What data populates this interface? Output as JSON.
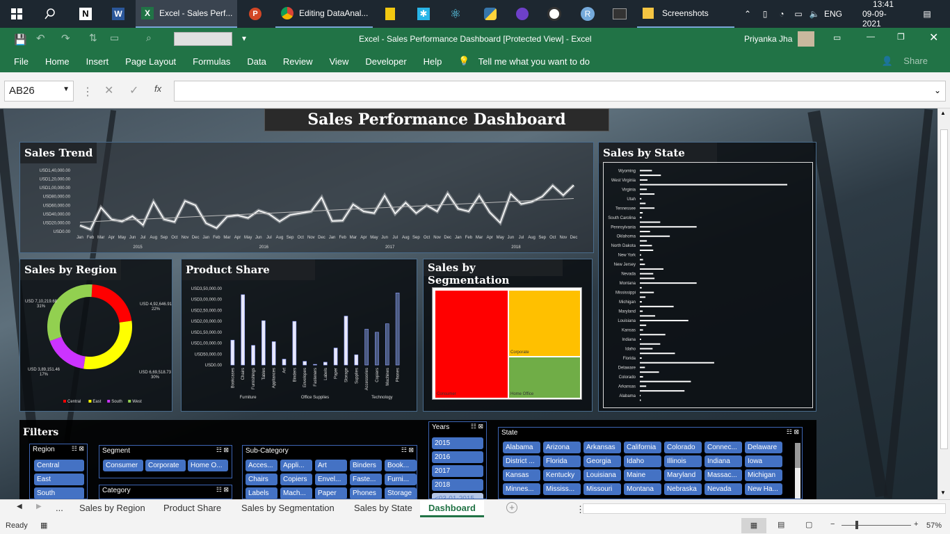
{
  "taskbar": {
    "apps": [
      {
        "label": "Excel - Sales Perf..."
      },
      {
        "label": "Editing DataAnal..."
      },
      {
        "label": "Screenshots"
      }
    ],
    "lang": "ENG",
    "time": "13:41",
    "date": "09-09-2021"
  },
  "excel": {
    "window_title": "Excel - Sales Performance Dashboard [Protected View] - Excel",
    "user": "Priyanka Jha",
    "share": "Share",
    "namebox": "AB26",
    "fx": "fx"
  },
  "ribbon": {
    "tabs": [
      "File",
      "Home",
      "Insert",
      "Page Layout",
      "Formulas",
      "Data",
      "Review",
      "View",
      "Developer",
      "Help"
    ],
    "tell_me": "Tell me what you want to do"
  },
  "dashboard": {
    "title": "Sales Performance Dashboard",
    "trend": {
      "title": "Sales Trend"
    },
    "region": {
      "title": "Sales by Region"
    },
    "product": {
      "title": "Product Share"
    },
    "segmentation": {
      "title": "Sales by Segmentation",
      "labels": [
        "Consumer",
        "Corporate",
        "Home Office"
      ]
    },
    "state": {
      "title": "Sales by State"
    },
    "filters": {
      "title": "Filters"
    }
  },
  "chart_data": [
    {
      "type": "line",
      "title": "Sales Trend",
      "ylim": [
        0,
        140000
      ],
      "yticks": [
        "USD0.00",
        "USD20,000.00",
        "USD40,000.00",
        "USD60,000.00",
        "USD80,000.00",
        "USD1,00,000.00",
        "USD1,20,000.00",
        "USD1,40,000.00"
      ],
      "x": [
        "Jan",
        "Feb",
        "Mar",
        "Apr",
        "May",
        "Jun",
        "Jul",
        "Aug",
        "Sep",
        "Oct",
        "Nov",
        "Dec",
        "Jan",
        "Feb",
        "Mar",
        "Apr",
        "May",
        "Jun",
        "Jul",
        "Aug",
        "Sep",
        "Oct",
        "Nov",
        "Dec",
        "Jan",
        "Feb",
        "Mar",
        "Apr",
        "May",
        "Jun",
        "Jul",
        "Aug",
        "Sep",
        "Oct",
        "Nov",
        "Dec",
        "Jan",
        "Feb",
        "Mar",
        "Apr",
        "May",
        "Jun",
        "Jul",
        "Aug",
        "Sep",
        "Oct",
        "Nov",
        "Dec"
      ],
      "years": [
        "2015",
        "2016",
        "2017",
        "2018"
      ],
      "series": [
        {
          "values": [
            14000,
            4800,
            55000,
            28000,
            23000,
            35000,
            15000,
            68000,
            28000,
            22000,
            70000,
            60000,
            19000,
            8000,
            34000,
            37000,
            31000,
            48000,
            40000,
            23000,
            38000,
            42000,
            46000,
            78000,
            24000,
            25000,
            62000,
            46000,
            42000,
            82000,
            41000,
            66000,
            42000,
            60000,
            46000,
            87000,
            52000,
            46000,
            82000,
            44000,
            20000,
            86000,
            63000,
            68000,
            80000,
            105000,
            83000,
            106000
          ]
        }
      ]
    },
    {
      "type": "pie",
      "title": "Sales by Region",
      "labels": [
        "Central",
        "East",
        "South",
        "West"
      ],
      "values": [
        492646.91,
        669518.73,
        389151.46,
        710219.68
      ],
      "data_labels": [
        "USD 4,92,646.91, 22%",
        "USD 6,69,518.73, 30%",
        "USD 3,89,151.46, 17%",
        "USD 7,10,219.68, 31%"
      ],
      "colors": [
        "#ff0000",
        "#ffff00",
        "#cc33ff",
        "#92d050"
      ]
    },
    {
      "type": "bar",
      "title": "Product Share",
      "ylim": [
        0,
        350000
      ],
      "yticks": [
        "USD0.00",
        "USD50,000.00",
        "USD1,00,000.00",
        "USD1,50,000.00",
        "USD2,00,000.00",
        "USD2,50,000.00",
        "USD3,00,000.00",
        "USD3,50,000.00"
      ],
      "groups": [
        {
          "name": "Furniture",
          "categories": [
            "Bookcases",
            "Chairs",
            "Furnishings",
            "Tables"
          ]
        },
        {
          "name": "Office Supplies",
          "categories": [
            "Appliances",
            "Art",
            "Binders",
            "Envelopes",
            "Fasteners",
            "Labels",
            "Paper",
            "Storage",
            "Supplies"
          ]
        },
        {
          "name": "Technology",
          "categories": [
            "Accessories",
            "Copiers",
            "Machines",
            "Phones"
          ]
        }
      ],
      "values": [
        114000,
        322000,
        90000,
        203000,
        107000,
        27000,
        200000,
        17000,
        3000,
        13000,
        78000,
        224000,
        47000,
        164000,
        150000,
        189000,
        330000
      ]
    },
    {
      "type": "bar",
      "title": "Sales by State",
      "categories": [
        "Wyoming",
        "West Virginia",
        "Virginia",
        "Utah",
        "Tennessee",
        "South Carolina",
        "Pennsylvania",
        "Oklahoma",
        "North Dakota",
        "New York",
        "New Jersey",
        "Nevada",
        "Montana",
        "Mississippi",
        "Michigan",
        "Maryland",
        "Louisiana",
        "Kansas",
        "Indiana",
        "Idaho",
        "Florida",
        "Delaware",
        "Colorado",
        "Arkansas",
        "Alabama"
      ],
      "values": [
        1600,
        1200,
        70000,
        10000,
        80000,
        5000,
        30000,
        8000,
        116500,
        3000,
        55000,
        20000,
        32000,
        2000,
        40000,
        5000,
        10000,
        76000,
        24000,
        4500,
        53000,
        3200,
        8800,
        22000,
        3000,
        89000,
        23000,
        21000,
        37000,
        8000,
        5000,
        2000,
        21000,
        19000,
        11000,
        47000,
        16000,
        89000,
        32000,
        3000,
        4500,
        23000,
        9000,
        2500,
        23000,
        11000,
        231000,
        12000,
        33000,
        19000
      ]
    }
  ],
  "slicers": {
    "region": {
      "title": "Region",
      "items": [
        "Central",
        "East",
        "South"
      ]
    },
    "segment": {
      "title": "Segment",
      "items": [
        "Consumer",
        "Corporate",
        "Home O..."
      ]
    },
    "category": {
      "title": "Category"
    },
    "subcat": {
      "title": "Sub-Category",
      "items": [
        "Acces...",
        "Appli...",
        "Art",
        "Binders",
        "Book...",
        "Chairs",
        "Copiers",
        "Envel...",
        "Faste...",
        "Furni...",
        "Labels",
        "Mach...",
        "Paper",
        "Phones",
        "Storage"
      ]
    },
    "years": {
      "title": "Years",
      "items": [
        "2015",
        "2016",
        "2017",
        "2018",
        "<03-01-2015"
      ]
    },
    "state": {
      "title": "State",
      "items": [
        "Alabama",
        "Arizona",
        "Arkansas",
        "California",
        "Colorado",
        "Connec...",
        "Delaware",
        "District ...",
        "Florida",
        "Georgia",
        "Idaho",
        "Illinois",
        "Indiana",
        "Iowa",
        "Kansas",
        "Kentucky",
        "Louisiana",
        "Maine",
        "Maryland",
        "Massac...",
        "Michigan",
        "Minnes...",
        "Mississ...",
        "Missouri",
        "Montana",
        "Nebraska",
        "Nevada",
        "New Ha..."
      ]
    }
  },
  "sheets": {
    "tabs": [
      "...",
      "Sales by Region",
      "Product Share",
      "Sales by Segmentation",
      "Sales by State",
      "Dashboard"
    ],
    "active": "Dashboard"
  },
  "status": {
    "ready": "Ready",
    "zoom": "57%"
  }
}
